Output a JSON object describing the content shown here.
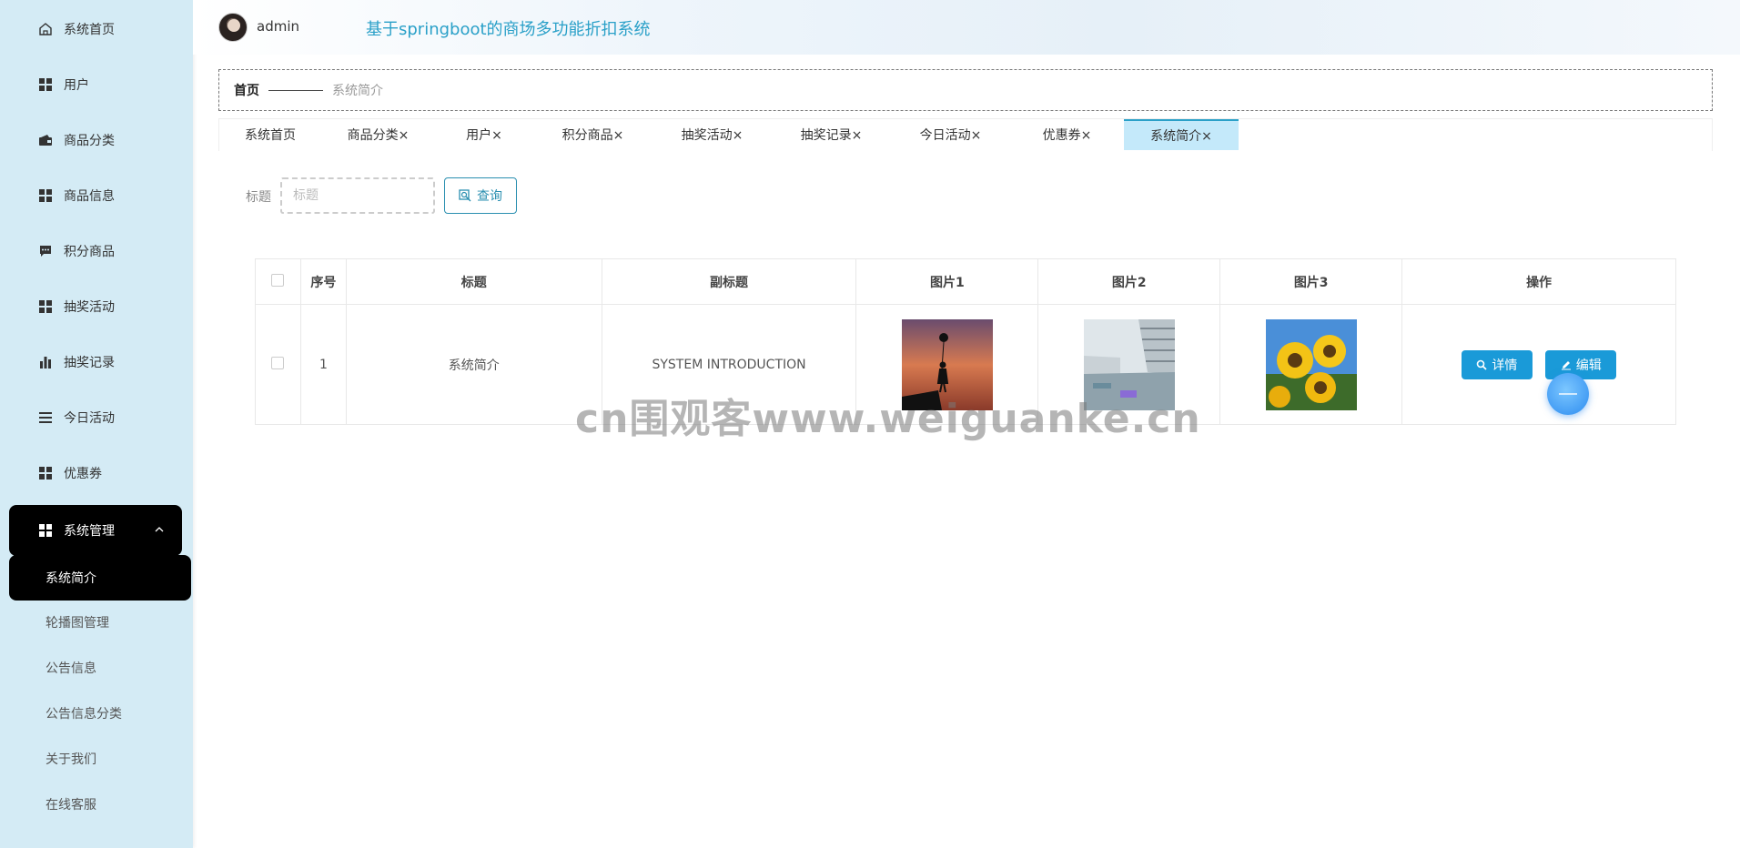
{
  "header": {
    "username": "admin",
    "app_title": "基于springboot的商场多功能折扣系统"
  },
  "sidebar": {
    "items": [
      {
        "label": "系统首页",
        "icon": "home-icon"
      },
      {
        "label": "用户",
        "icon": "grid-icon"
      },
      {
        "label": "商品分类",
        "icon": "wallet-icon"
      },
      {
        "label": "商品信息",
        "icon": "grid-icon"
      },
      {
        "label": "积分商品",
        "icon": "chat-icon"
      },
      {
        "label": "抽奖活动",
        "icon": "grid-icon"
      },
      {
        "label": "抽奖记录",
        "icon": "bar-chart-icon"
      },
      {
        "label": "今日活动",
        "icon": "list-icon"
      },
      {
        "label": "优惠券",
        "icon": "grid-icon"
      }
    ],
    "group": {
      "label": "系统管理",
      "icon": "grid-icon",
      "caret": "^"
    },
    "sub_items": [
      {
        "label": "系统简介"
      },
      {
        "label": "轮播图管理"
      },
      {
        "label": "公告信息"
      },
      {
        "label": "公告信息分类"
      },
      {
        "label": "关于我们"
      },
      {
        "label": "在线客服"
      }
    ]
  },
  "breadcrumb": {
    "home": "首页",
    "current": "系统简介"
  },
  "tabs": [
    {
      "label": "系统首页"
    },
    {
      "label": "商品分类×"
    },
    {
      "label": "用户×"
    },
    {
      "label": "积分商品×"
    },
    {
      "label": "抽奖活动×"
    },
    {
      "label": "抽奖记录×"
    },
    {
      "label": "今日活动×"
    },
    {
      "label": "优惠券×"
    },
    {
      "label": "系统简介×"
    }
  ],
  "search": {
    "label": "标题",
    "placeholder": "标题",
    "button": "查询"
  },
  "table": {
    "headers": [
      "序号",
      "标题",
      "副标题",
      "图片1",
      "图片2",
      "图片3",
      "操作"
    ],
    "rows": [
      {
        "index": "1",
        "title": "系统简介",
        "subtitle": "SYSTEM INTRODUCTION"
      }
    ],
    "actions": {
      "detail": "详情",
      "edit": "编辑"
    }
  },
  "watermark": "cn围观客www.weiguanke.cn",
  "colors": {
    "accent": "#2aa0c8",
    "sidebar_bg": "#d4ebf5",
    "button_blue": "#1a9ad8",
    "active_tab": "#c4e9fa"
  }
}
